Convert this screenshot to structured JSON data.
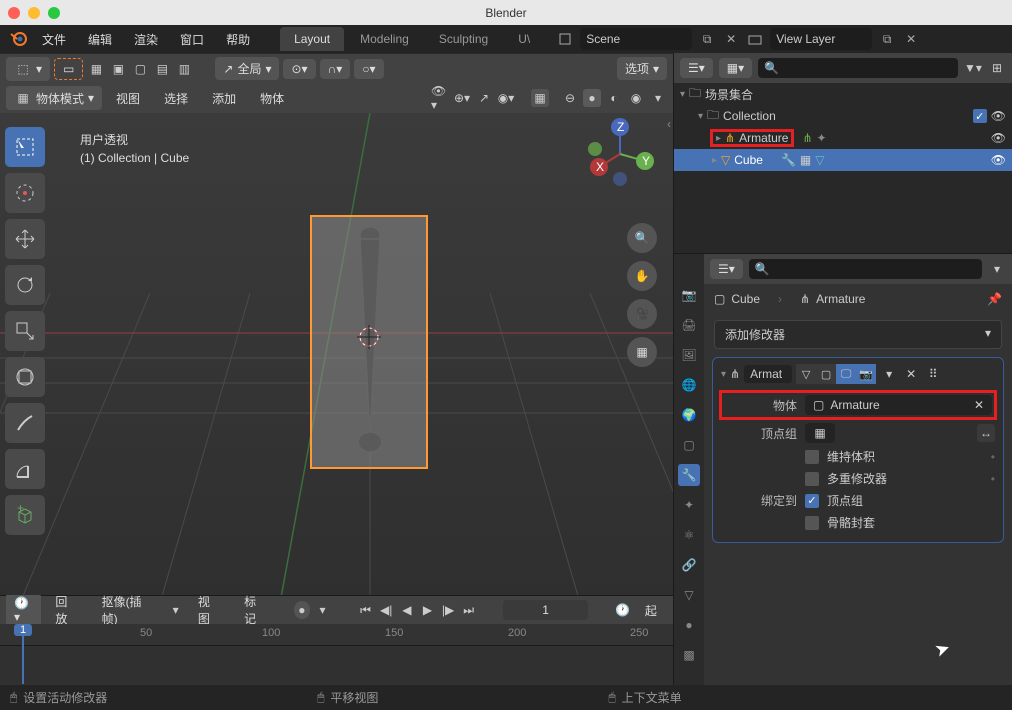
{
  "titlebar": {
    "title": "Blender"
  },
  "menus": {
    "file": "文件",
    "edit": "编辑",
    "render": "渲染",
    "window": "窗口",
    "help": "帮助"
  },
  "workspaces": {
    "layout": "Layout",
    "modeling": "Modeling",
    "sculpting": "Sculpting",
    "uv": "U\\"
  },
  "scene": {
    "name": "Scene"
  },
  "view_layer": {
    "name": "View Layer"
  },
  "header3d": {
    "mode": "物体模式",
    "global": "全局",
    "options": "选项",
    "view": "视图",
    "select": "选择",
    "add": "添加",
    "object": "物体"
  },
  "viewport": {
    "overlay_line1": "用户透视",
    "overlay_line2": "(1) Collection | Cube",
    "axes": {
      "x": "X",
      "y": "Y",
      "z": "Z"
    }
  },
  "timeline": {
    "playback": "回放",
    "keying": "抠像(插帧)",
    "view": "视图",
    "marker": "标记",
    "frame": "1",
    "start_label": "起",
    "ticks": {
      "t50": "50",
      "t100": "100",
      "t150": "150",
      "t200": "200",
      "t250": "250"
    }
  },
  "outliner": {
    "scene_collection": "场景集合",
    "collection": "Collection",
    "armature": "Armature",
    "cube": "Cube"
  },
  "properties": {
    "breadcrumb": {
      "cube": "Cube",
      "armature": "Armature"
    },
    "add_modifier": "添加修改器",
    "modifier": {
      "name": "Armat",
      "object_label": "物体",
      "object_value": "Armature",
      "vgroup_label": "顶点组",
      "preserve_volume": "维持体积",
      "multi_modifier": "多重修改器",
      "bind_to": "绑定到",
      "vertex_groups": "顶点组",
      "bone_envelopes": "骨骼封套"
    }
  },
  "statusbar": {
    "hint1": "设置活动修改器",
    "hint2": "平移视图",
    "hint3": "上下文菜单"
  }
}
